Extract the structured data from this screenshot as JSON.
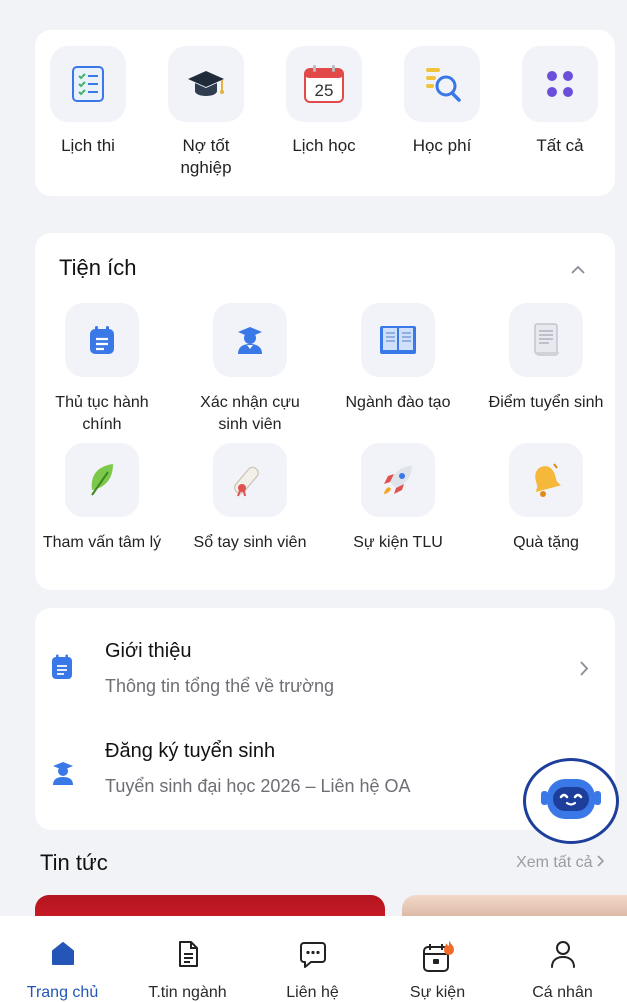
{
  "quick_access": {
    "items": [
      {
        "label": "Lịch thi",
        "icon": "checklist-icon"
      },
      {
        "label": "Nợ tốt nghiệp",
        "icon": "graduation-cap-icon"
      },
      {
        "label": "Lịch học",
        "icon": "calendar-icon",
        "calendar_day": "25"
      },
      {
        "label": "Học phí",
        "icon": "document-search-icon"
      },
      {
        "label": "Tất cả",
        "icon": "grid-dots-icon"
      }
    ]
  },
  "utilities": {
    "title": "Tiện ích",
    "items": [
      {
        "label": "Thủ tục hành chính",
        "icon": "clipboard-icon"
      },
      {
        "label": "Xác nhận cựu sinh viên",
        "icon": "graduate-person-icon"
      },
      {
        "label": "Ngành đào tạo",
        "icon": "open-book-icon"
      },
      {
        "label": "Điểm tuyển sinh",
        "icon": "document-scroll-icon"
      },
      {
        "label": "Tham vấn tâm lý",
        "icon": "leaf-icon"
      },
      {
        "label": "Sổ tay sinh viên",
        "icon": "diploma-scroll-icon"
      },
      {
        "label": "Sự kiện TLU",
        "icon": "rocket-icon"
      },
      {
        "label": "Quà tặng",
        "icon": "bell-icon"
      }
    ]
  },
  "info": {
    "rows": [
      {
        "title": "Giới thiệu",
        "subtitle": "Thông tin tổng thể về trường",
        "icon": "clipboard-icon"
      },
      {
        "title": "Đăng ký tuyển sinh",
        "subtitle": "Tuyển sinh đại học 2026 – Liên hệ OA",
        "icon": "graduate-person-icon"
      }
    ]
  },
  "news": {
    "title": "Tin tức",
    "see_all": "Xem tất cả"
  },
  "tabs": [
    {
      "label": "Trang chủ",
      "icon": "home-icon",
      "active": true
    },
    {
      "label": "T.tin ngành",
      "icon": "document-icon"
    },
    {
      "label": "Liên hệ",
      "icon": "chat-bubble-icon"
    },
    {
      "label": "Sự kiện",
      "icon": "calendar-fire-icon"
    },
    {
      "label": "Cá nhân",
      "icon": "person-icon"
    }
  ],
  "colors": {
    "accent": "#2456b8",
    "icon_blue": "#3a78e8",
    "bot_border": "#1d3f9b"
  }
}
